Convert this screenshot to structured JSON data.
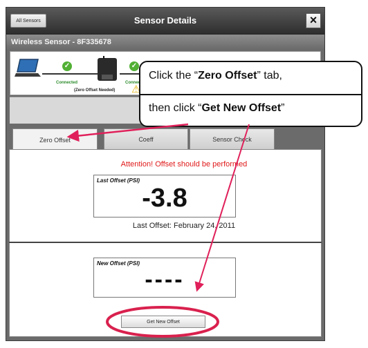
{
  "window": {
    "all_sensors_label": "All Sensors",
    "title": "Sensor Details",
    "close_label": "×",
    "sensor_name": "Wireless Sensor - 8F335678"
  },
  "status": {
    "connected_1": "Connected",
    "connected_2": "Connect",
    "zero_offset_needed": "(Zero Offset Needed)"
  },
  "tabs": [
    {
      "label": "Zero Offset",
      "active": true
    },
    {
      "label": "Coeff",
      "active": false
    },
    {
      "label": "Sensor Check",
      "active": false
    }
  ],
  "zero_offset": {
    "attention": "Attention! Offset should be performed",
    "last_offset_header": "Last Offset (PSI)",
    "last_offset_value": "-3.8",
    "last_offset_date": "Last Offset: February 24, 2011",
    "new_offset_header": "New Offset (PSI)",
    "new_offset_value": "----",
    "get_new_offset_label": "Get New Offset"
  },
  "callout": {
    "line1_pre": "Click the “",
    "line1_bold": "Zero Offset",
    "line1_post": "” tab,",
    "line2_pre": "then click “",
    "line2_bold": "Get New Offset",
    "line2_post": "”"
  },
  "colors": {
    "attention": "#e01818",
    "annotation": "#e0205a",
    "connected": "#2a8a2a"
  },
  "icons": [
    "laptop-icon",
    "check-icon",
    "router-icon",
    "warning-icon",
    "close-icon"
  ]
}
